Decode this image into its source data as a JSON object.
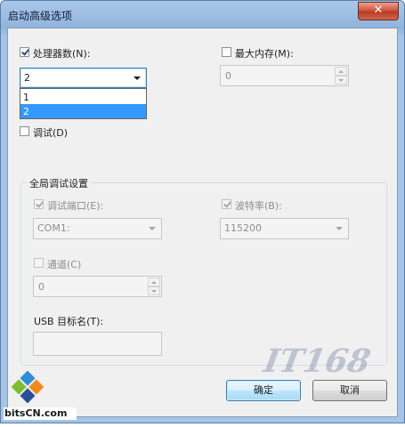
{
  "window": {
    "title": "启动高级选项",
    "close_glyph": "✕"
  },
  "processors": {
    "checkbox_label": "处理器数(N):",
    "checked": true,
    "selected": "2",
    "options": [
      "1",
      "2"
    ],
    "highlighted": "2"
  },
  "max_memory": {
    "checkbox_label": "最大内存(M):",
    "checked": false,
    "value": "0"
  },
  "debug": {
    "checkbox_label": "调试(D)",
    "checked": false
  },
  "global_debug": {
    "title": "全局调试设置",
    "debug_port": {
      "label": "调试端口(E):",
      "checked": true,
      "value": "COM1:"
    },
    "baud_rate": {
      "label": "波特率(B):",
      "checked": true,
      "value": "115200"
    },
    "channel": {
      "label": "通道(C)",
      "checked": false,
      "value": "0"
    },
    "usb_target": {
      "label": "USB 目标名(T):",
      "value": ""
    }
  },
  "buttons": {
    "ok": "确定",
    "cancel": "取消"
  },
  "watermark": {
    "site": "bitsCN.com",
    "brand": "IT168"
  },
  "colors": {
    "selection": "#3399ff",
    "titlebar": "#9cbde2",
    "close": "#c74a33"
  }
}
